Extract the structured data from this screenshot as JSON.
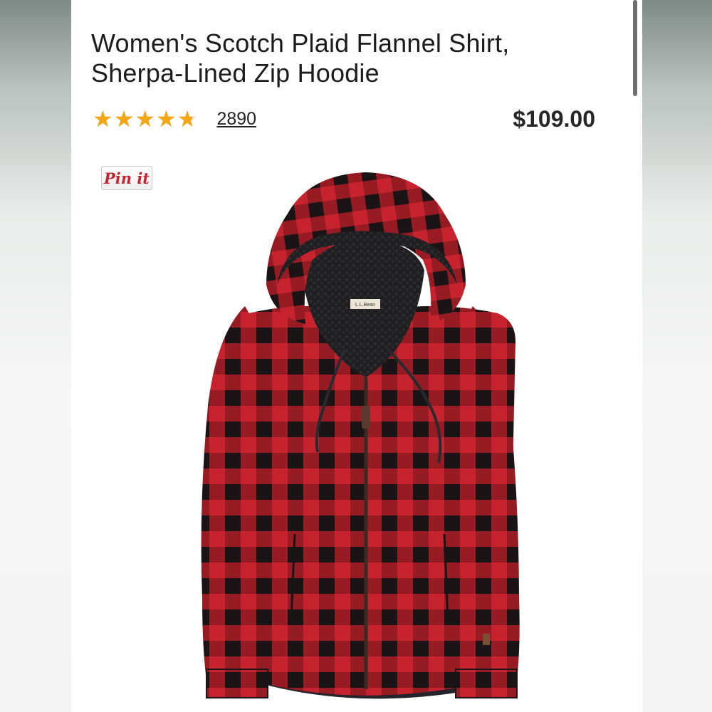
{
  "product": {
    "title_line1": "Women's Scotch Plaid Flannel Shirt,",
    "title_line2": "Sherpa-Lined Zip Hoodie",
    "rating": 4.7,
    "rating_max": 5,
    "review_count": "2890",
    "price": "$109.00",
    "image_label": "L.L.Bean"
  },
  "pinterest": {
    "label": "Pin it"
  },
  "colors": {
    "star": "#f3a716",
    "plaid_red": "#c7232f",
    "plaid_black": "#1b1416",
    "pin_red": "#c8232c"
  },
  "icons": {
    "stars": "star-rating-icon",
    "pinterest": "pinterest-icon"
  }
}
